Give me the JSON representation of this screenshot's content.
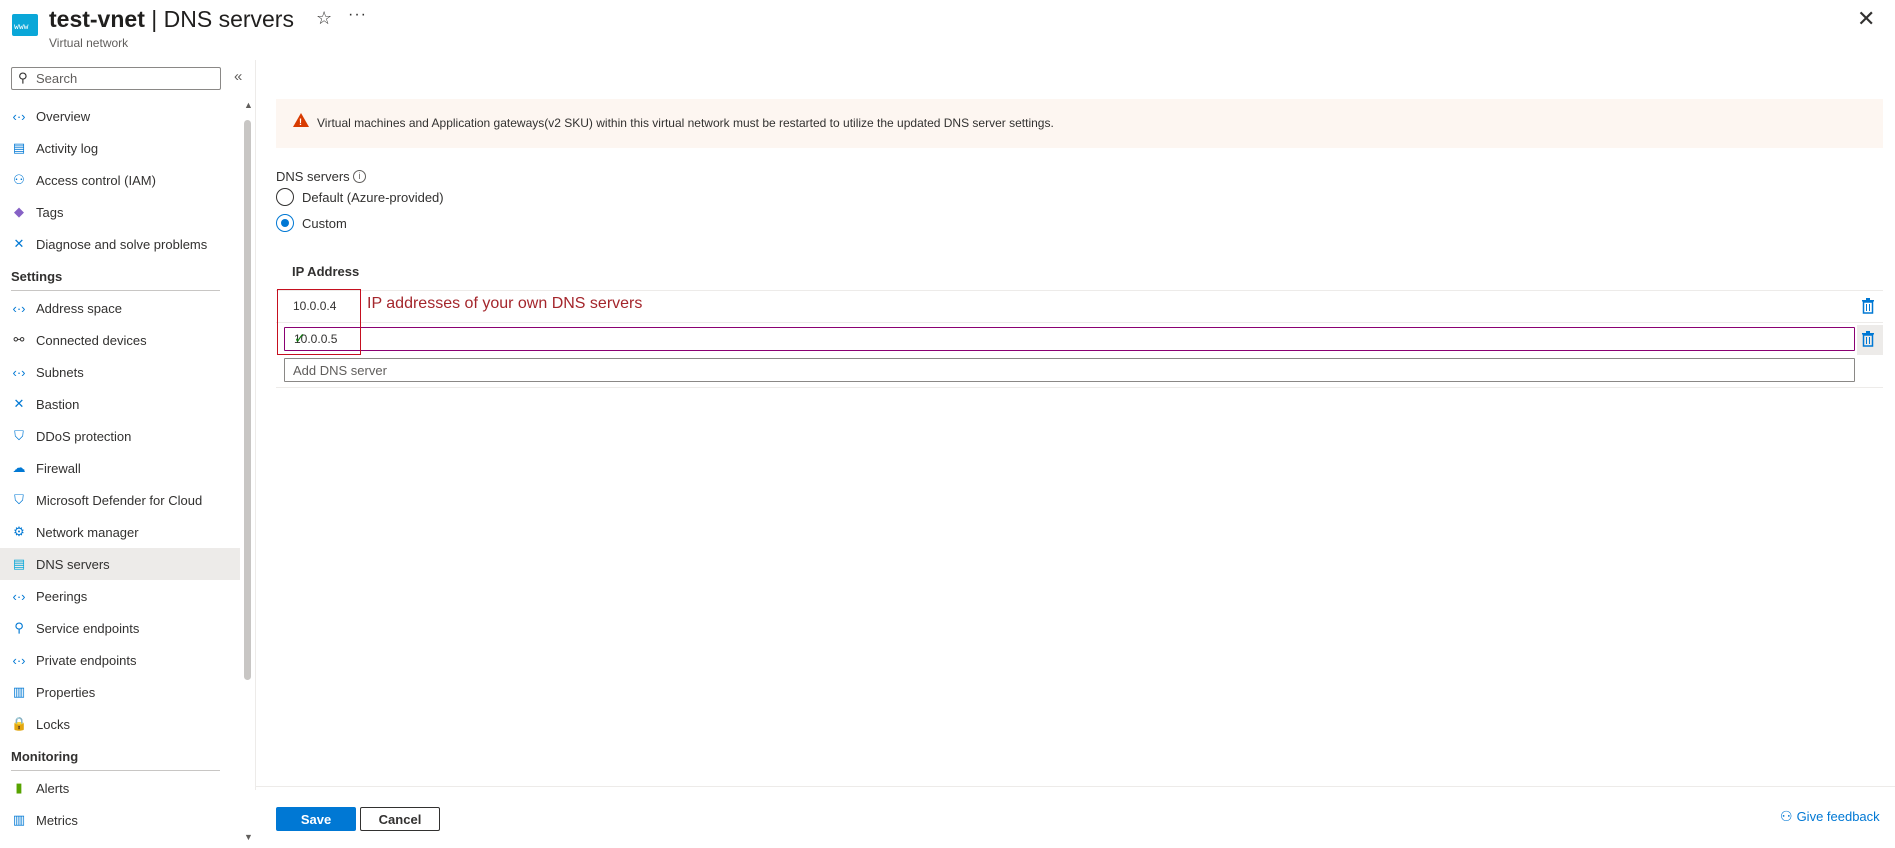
{
  "header": {
    "resource_icon_text": "www",
    "title_bold": "test-vnet",
    "title_rest": " | DNS servers",
    "subtitle": "Virtual network",
    "star_icon": "star-icon",
    "more_icon": "more-icon",
    "close_icon": "close-icon"
  },
  "sidebar": {
    "search_placeholder": "Search",
    "items_top": [
      {
        "label": "Overview",
        "icon": "overview-icon",
        "glyph": "‹·›",
        "color": "#0078d4"
      },
      {
        "label": "Activity log",
        "icon": "activity-log-icon",
        "glyph": "▤",
        "color": "#0078d4"
      },
      {
        "label": "Access control (IAM)",
        "icon": "iam-icon",
        "glyph": "⚇",
        "color": "#0078d4"
      },
      {
        "label": "Tags",
        "icon": "tag-icon",
        "glyph": "◆",
        "color": "#8661c5"
      },
      {
        "label": "Diagnose and solve problems",
        "icon": "diagnose-icon",
        "glyph": "✕",
        "color": "#0078d4"
      }
    ],
    "settings_heading": "Settings",
    "settings_items": [
      {
        "label": "Address space",
        "icon": "address-space-icon",
        "glyph": "‹·›",
        "color": "#0078d4"
      },
      {
        "label": "Connected devices",
        "icon": "connected-devices-icon",
        "glyph": "⚯",
        "color": "#323130"
      },
      {
        "label": "Subnets",
        "icon": "subnets-icon",
        "glyph": "‹·›",
        "color": "#0078d4"
      },
      {
        "label": "Bastion",
        "icon": "bastion-icon",
        "glyph": "✕",
        "color": "#0078d4"
      },
      {
        "label": "DDoS protection",
        "icon": "ddos-shield-icon",
        "glyph": "⛉",
        "color": "#0078d4"
      },
      {
        "label": "Firewall",
        "icon": "firewall-icon",
        "glyph": "☁",
        "color": "#0078d4"
      },
      {
        "label": "Microsoft Defender for Cloud",
        "icon": "defender-shield-icon",
        "glyph": "⛉",
        "color": "#0078d4"
      },
      {
        "label": "Network manager",
        "icon": "network-manager-icon",
        "glyph": "⚙",
        "color": "#0078d4"
      },
      {
        "label": "DNS servers",
        "icon": "dns-servers-icon",
        "glyph": "▤",
        "color": "#0aa7d8",
        "selected": true
      },
      {
        "label": "Peerings",
        "icon": "peerings-icon",
        "glyph": "‹·›",
        "color": "#0078d4"
      },
      {
        "label": "Service endpoints",
        "icon": "service-endpoints-icon",
        "glyph": "⚲",
        "color": "#0078d4"
      },
      {
        "label": "Private endpoints",
        "icon": "private-endpoints-icon",
        "glyph": "‹·›",
        "color": "#0078d4"
      },
      {
        "label": "Properties",
        "icon": "properties-icon",
        "glyph": "▥",
        "color": "#0078d4"
      },
      {
        "label": "Locks",
        "icon": "lock-icon",
        "glyph": "🔒",
        "color": "#0078d4"
      }
    ],
    "monitoring_heading": "Monitoring",
    "monitoring_items": [
      {
        "label": "Alerts",
        "icon": "alerts-icon",
        "glyph": "▮",
        "color": "#57a300"
      },
      {
        "label": "Metrics",
        "icon": "metrics-icon",
        "glyph": "▥",
        "color": "#0078d4"
      }
    ]
  },
  "main": {
    "banner_text": "Virtual machines and Application gateways(v2 SKU) within this virtual network must be restarted to utilize the updated DNS server settings.",
    "dns_servers_label": "DNS servers",
    "radio_default_label": "Default (Azure-provided)",
    "radio_custom_label": "Custom",
    "selected_radio": "Custom",
    "column_header": "IP Address",
    "ip_rows": [
      "10.0.0.4",
      "10.0.0.5"
    ],
    "add_placeholder": "Add DNS server",
    "annotation_text": "IP addresses of your own DNS servers"
  },
  "footer": {
    "save_label": "Save",
    "cancel_label": "Cancel",
    "feedback_label": "Give feedback"
  },
  "colors": {
    "accent": "#0078d4",
    "warning": "#d83b01",
    "annotation": "#c50f1f"
  }
}
